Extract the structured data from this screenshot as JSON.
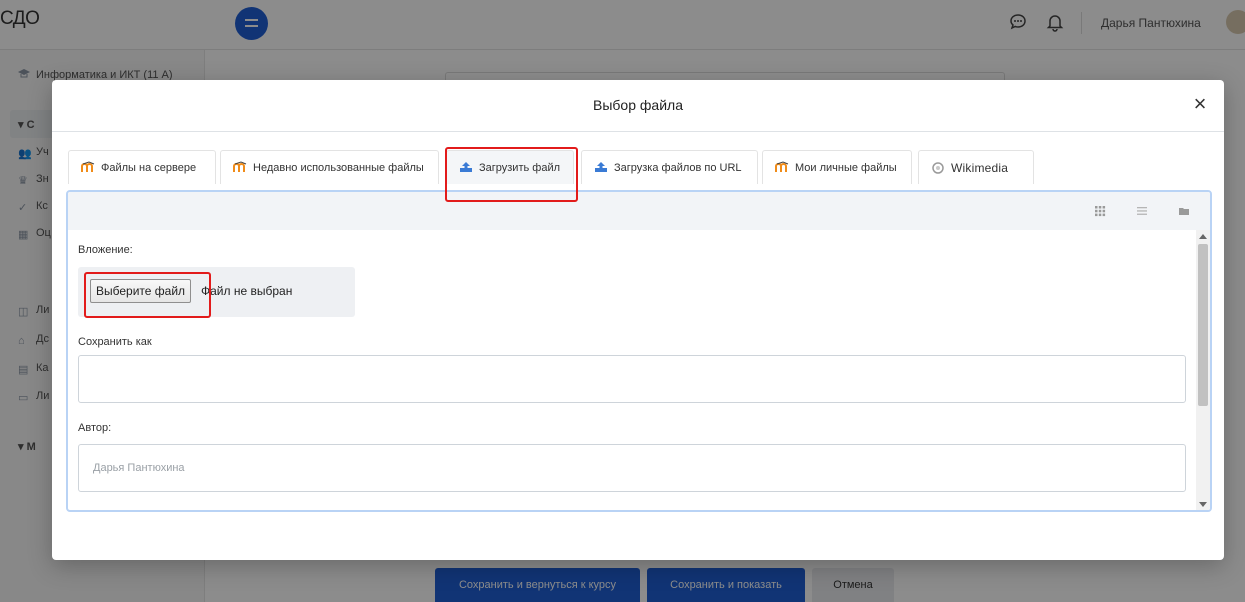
{
  "app": {
    "brand": "СДО"
  },
  "header": {
    "username": "Дарья Пантюхина",
    "chat_icon": "chat-bubble-icon",
    "bell_icon": "bell-icon"
  },
  "sidebar": {
    "course": "Информатика и ИКТ (11 А)",
    "items": [
      {
        "label": "С",
        "icon": "chevron-down-icon"
      },
      {
        "label": "Уч",
        "icon": "users-icon"
      },
      {
        "label": "Зн",
        "icon": "trophy-icon"
      },
      {
        "label": "Кс",
        "icon": "check-icon"
      },
      {
        "label": "Оц",
        "icon": "table-icon"
      },
      {
        "label": "Ли",
        "icon": "dashboard-icon"
      },
      {
        "label": "Дс",
        "icon": "home-icon"
      },
      {
        "label": "Ка",
        "icon": "calendar-icon"
      },
      {
        "label": "Ли",
        "icon": "folder-icon"
      },
      {
        "label": "М",
        "icon": "chevron-down-icon"
      }
    ]
  },
  "footer": {
    "save_return": "Сохранить и вернуться к курсу",
    "save_show": "Сохранить и показать",
    "cancel": "Отмена"
  },
  "dialog": {
    "title": "Выбор файла",
    "close": "×",
    "tabs": [
      {
        "label": "Файлы на сервере",
        "icon": "moodle-icon"
      },
      {
        "label": "Недавно использованные файлы",
        "icon": "moodle-icon"
      },
      {
        "label": "Загрузить файл",
        "icon": "upload-icon",
        "active": true
      },
      {
        "label": "Загрузка файлов по URL",
        "icon": "upload-icon"
      },
      {
        "label": "Мои личные файлы",
        "icon": "moodle-icon"
      },
      {
        "label": "Wikimedia",
        "icon": "wikimedia-icon"
      }
    ],
    "view_buttons": [
      "grid-view-icon",
      "list-view-icon",
      "folder-view-icon"
    ],
    "attachment_label": "Вложение:",
    "choose_file": "Выберите файл",
    "no_file": "Файл не выбран",
    "save_as_label": "Сохранить как",
    "save_as_value": "",
    "author_label": "Автор:",
    "author_placeholder": "Дарья Пантюхина"
  },
  "colors": {
    "primary": "#1f5fd6",
    "highlight": "#e21b1b",
    "panel_border": "#b9d3f5",
    "moodle_orange": "#f08c1a"
  }
}
